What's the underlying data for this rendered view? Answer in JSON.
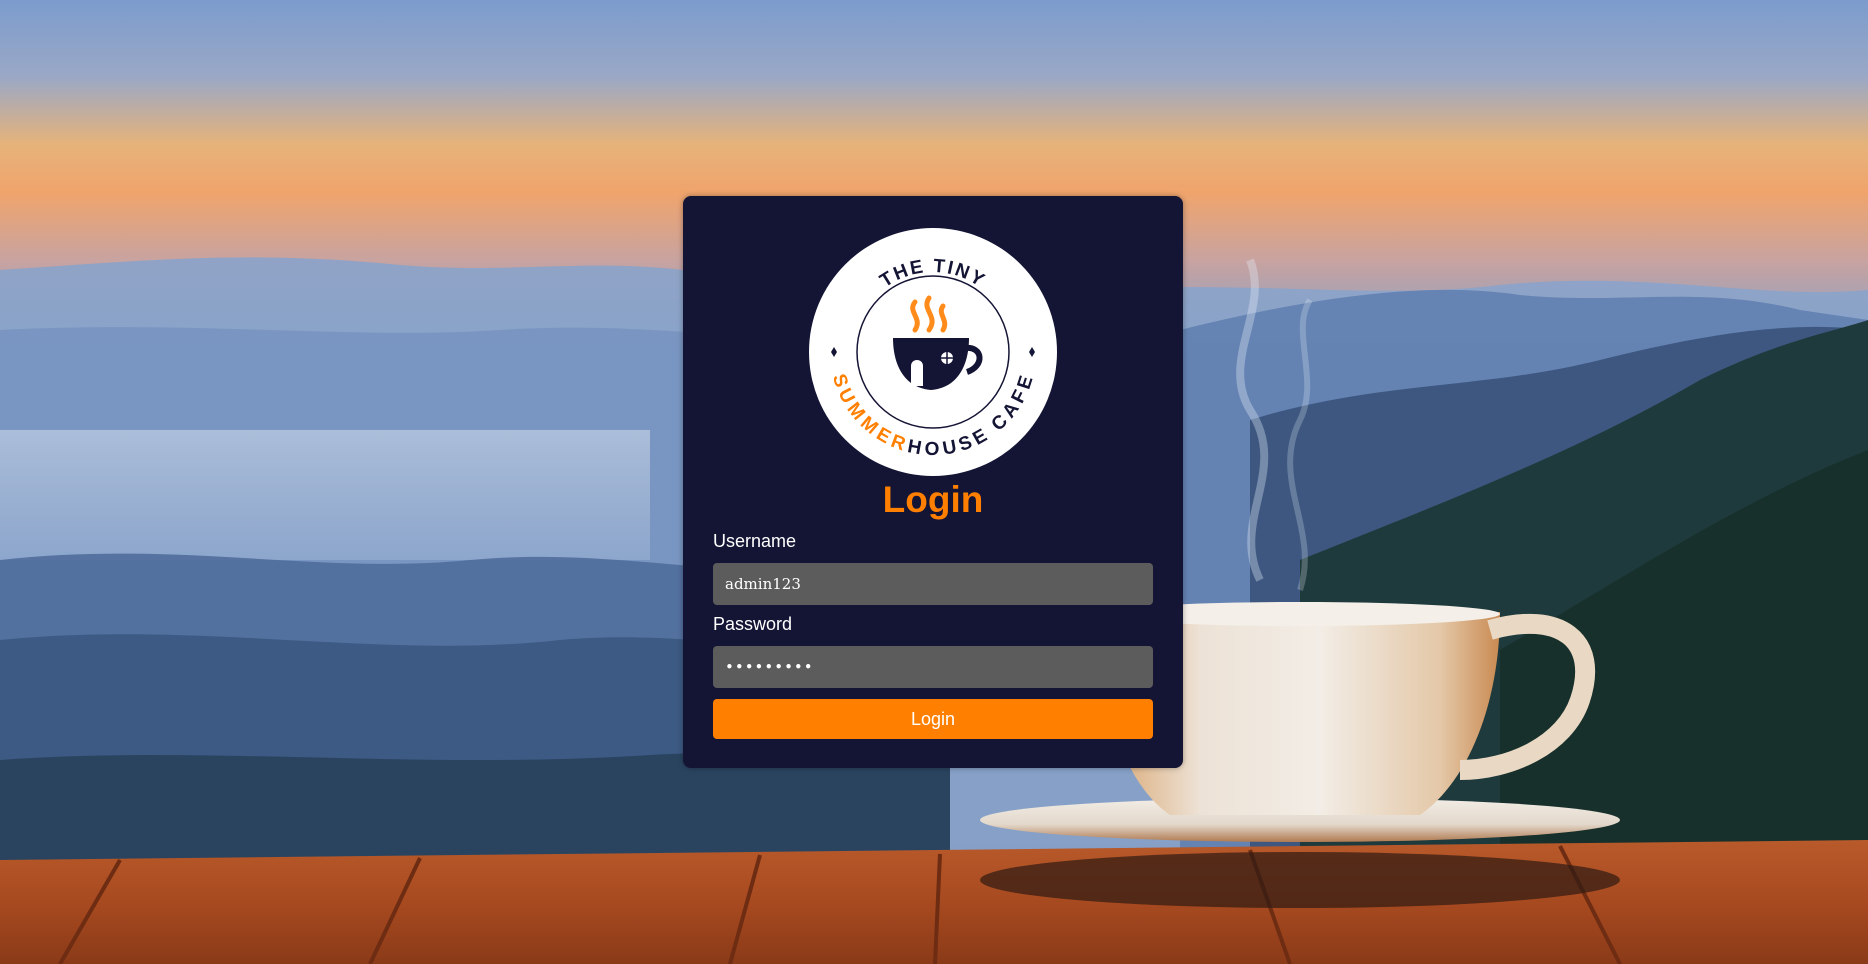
{
  "logo": {
    "top_text": "THE TINY",
    "bottom_text_accent": "SUMMER",
    "bottom_text_main": "HOUSE CAFE",
    "icon": "coffee-cup-house-icon"
  },
  "login": {
    "title": "Login",
    "username_label": "Username",
    "username_value": "admin123",
    "password_label": "Password",
    "password_value": "•••••••••",
    "button_label": "Login"
  },
  "colors": {
    "card_bg": "#141435",
    "accent": "#ff7f00",
    "input_bg": "#5c5c5c",
    "text": "#ffffff"
  }
}
